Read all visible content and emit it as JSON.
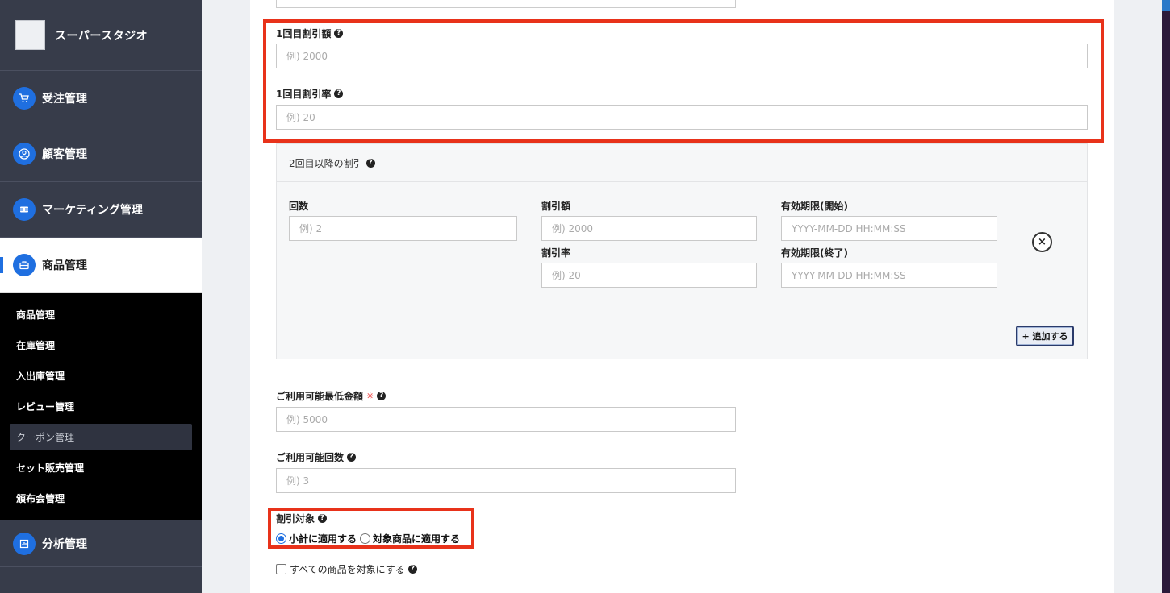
{
  "sidebar": {
    "brand_name": "スーパースタジオ",
    "nav": {
      "orders": "受注管理",
      "customers": "顧客管理",
      "marketing": "マーケティング管理",
      "products": "商品管理",
      "analytics": "分析管理"
    },
    "submenu": [
      "商品管理",
      "在庫管理",
      "入出庫管理",
      "レビュー管理",
      "クーポン管理",
      "セット販売管理",
      "頒布会管理"
    ]
  },
  "form": {
    "first_discount_amount": {
      "label": "1回目割引額",
      "placeholder": "例) 2000"
    },
    "first_discount_rate": {
      "label": "1回目割引率",
      "placeholder": "例) 20"
    },
    "repeat": {
      "title": "2回目以降の割引",
      "count": {
        "label": "回数",
        "placeholder": "例) 2"
      },
      "amount": {
        "label": "割引額",
        "placeholder": "例) 2000"
      },
      "rate": {
        "label": "割引率",
        "placeholder": "例) 20"
      },
      "start": {
        "label": "有効期限(開始)",
        "placeholder": "YYYY-MM-DD HH:MM:SS"
      },
      "end": {
        "label": "有効期限(終了)",
        "placeholder": "YYYY-MM-DD HH:MM:SS"
      },
      "add_button": "+ 追加する",
      "remove_button": "×"
    },
    "min_amount": {
      "label": "ご利用可能最低金額",
      "required_mark": "※",
      "placeholder": "例) 5000"
    },
    "usage_count": {
      "label": "ご利用可能回数",
      "placeholder": "例) 3"
    },
    "discount_target": {
      "label": "割引対象",
      "options": [
        "小計に適用する",
        "対象商品に適用する"
      ],
      "selected": "小計に適用する"
    },
    "all_products": {
      "label": "すべての商品を対象にする",
      "checked": false
    }
  },
  "colors": {
    "accent": "#1f6fe0",
    "highlight": "#e8321a",
    "sidebar": "#373c4a"
  }
}
